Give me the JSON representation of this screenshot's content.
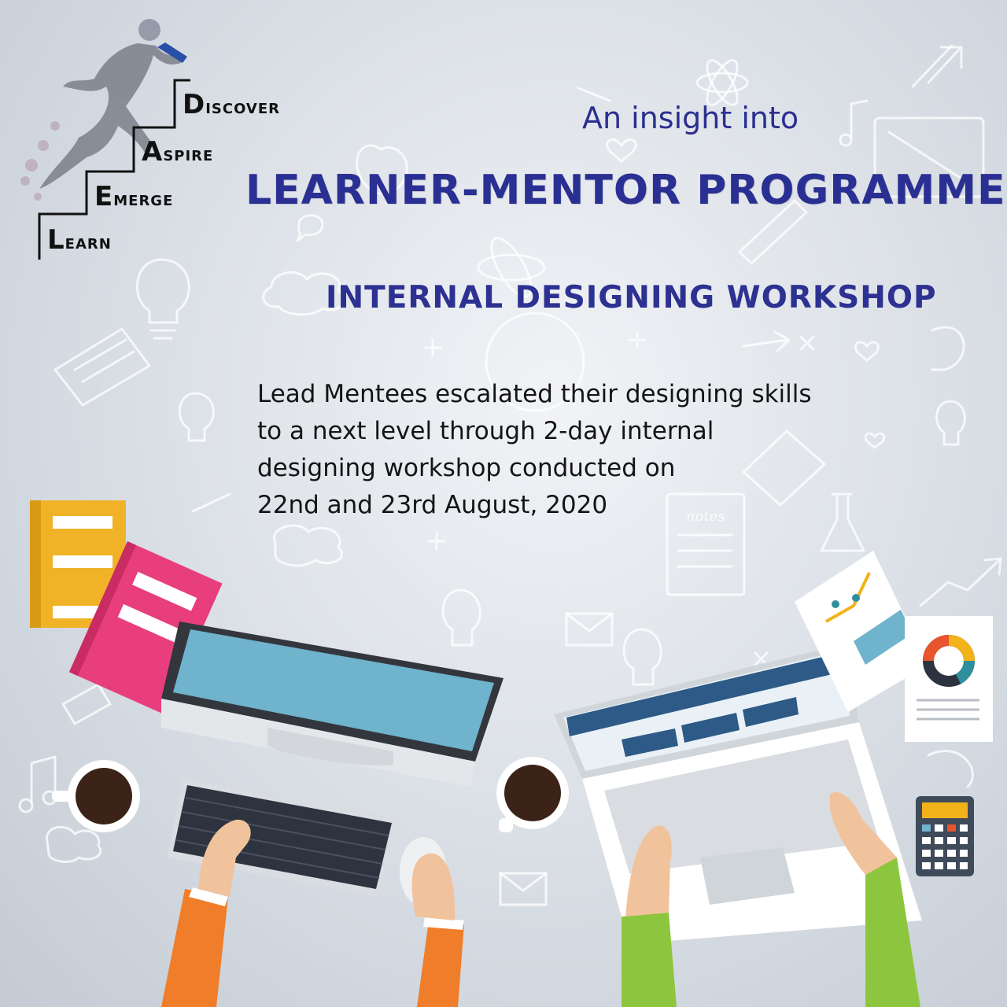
{
  "logo": {
    "words": [
      {
        "cap": "D",
        "rest": "ISCOVER"
      },
      {
        "cap": "A",
        "rest": "SPIRE"
      },
      {
        "cap": "E",
        "rest": "MERGE"
      },
      {
        "cap": "L",
        "rest": "EARN"
      }
    ]
  },
  "header": {
    "subtitle": "An insight into",
    "title": "LEARNER-MENTOR PROGRAMME",
    "event": "INTERNAL DESIGNING WORKSHOP"
  },
  "description": {
    "lines": [
      "Lead Mentees escalated their designing skills",
      "to a next level through 2-day internal",
      "designing workshop conducted on",
      "22nd and 23rd August, 2020"
    ]
  },
  "illustration": {
    "notes_label": "notes"
  },
  "colors": {
    "title_blue": "#2a2f93",
    "book_yellow": "#f0b227",
    "book_pink": "#e83e7c",
    "screen_blue": "#6fb3cd",
    "sleeve_orange": "#f07d2a",
    "sleeve_green": "#8cc63f"
  }
}
